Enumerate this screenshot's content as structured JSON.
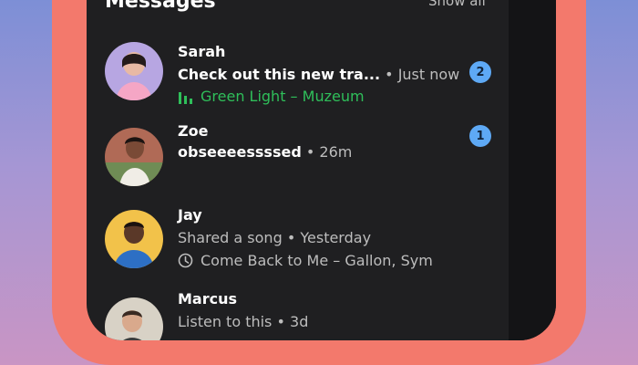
{
  "header": {
    "title": "Messages",
    "show_all": "Show all"
  },
  "messages": [
    {
      "name": "Sarah",
      "preview": "Check out this new tra...",
      "time": "Just now",
      "track": "Green Light – Muzeum",
      "unread": "2",
      "colors": {
        "avatar_bg": "#b7a6e2",
        "track": "#2fbf5a"
      }
    },
    {
      "name": "Zoe",
      "preview": "obseeeessssed",
      "time": "26m",
      "unread": "1",
      "colors": {
        "avatar_bg": "#b06a56"
      }
    },
    {
      "name": "Jay",
      "preview": "Shared a song",
      "time": "Yesterday",
      "track": "Come Back to Me – Gallon, Sym",
      "colors": {
        "avatar_bg": "#f2c24a"
      }
    },
    {
      "name": "Marcus",
      "preview": "Listen to this",
      "time": "3d",
      "colors": {
        "avatar_bg": "#d8d2c6"
      }
    }
  ],
  "separator": "•",
  "icons": {
    "equalizer": "equalizer-icon",
    "clock": "clock-icon"
  }
}
